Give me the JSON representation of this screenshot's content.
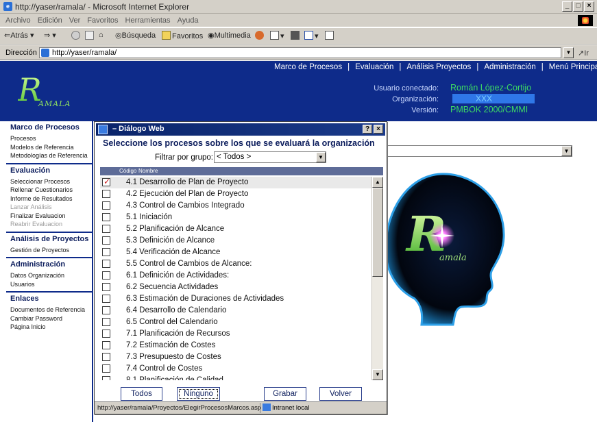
{
  "browser": {
    "title": "http://yaser/ramala/ - Microsoft Internet Explorer",
    "menu": [
      "Archivo",
      "Edición",
      "Ver",
      "Favoritos",
      "Herramientas",
      "Ayuda"
    ],
    "toolbar": {
      "back": "Atrás",
      "search": "Búsqueda",
      "favorites": "Favoritos",
      "media": "Multimedia"
    },
    "address_label": "Dirección",
    "address_value": "http://yaser/ramala/",
    "go_label": "Ir"
  },
  "header": {
    "nav": [
      "Marco de Procesos",
      "Evaluación",
      "Análisis Proyectos",
      "Administración",
      "Menú Principal"
    ],
    "logo_text": "R",
    "logo_sub": "AMALA",
    "user_label": "Usuario conectado:",
    "user_value": "Román López-Cortijo",
    "org_label": "Organización:",
    "org_value": "XXX",
    "version_label": "Versión:",
    "version_value": "PMBOK 2000/CMMI"
  },
  "sidebar": [
    {
      "title": "Marco de Procesos",
      "items": [
        {
          "label": "Procesos",
          "disabled": false
        },
        {
          "label": "Modelos de Referencia",
          "disabled": false
        },
        {
          "label": "Metodologías de Referencia",
          "disabled": false
        }
      ]
    },
    {
      "title": "Evaluación",
      "items": [
        {
          "label": "Seleccionar Procesos",
          "disabled": false
        },
        {
          "label": "Rellenar Cuestionarios",
          "disabled": false
        },
        {
          "label": "Informe de Resultados",
          "disabled": false
        },
        {
          "label": "Lanzar Análisis",
          "disabled": true
        },
        {
          "label": "Finalizar Evaluacion",
          "disabled": false
        },
        {
          "label": "Reabrir Evaluacion",
          "disabled": true
        }
      ]
    },
    {
      "title": "Análisis de Proyectos",
      "items": [
        {
          "label": "Gestión de Proyectos",
          "disabled": false
        }
      ]
    },
    {
      "title": "Administración",
      "items": [
        {
          "label": "Datos Organización",
          "disabled": false
        },
        {
          "label": "Usuarios",
          "disabled": false
        }
      ]
    },
    {
      "title": "Enlaces",
      "items": [
        {
          "label": "Documentos de Referencia",
          "disabled": false
        },
        {
          "label": "Cambiar Password",
          "disabled": false
        },
        {
          "label": "Página Inicio",
          "disabled": false
        }
      ]
    }
  ],
  "head_logo": {
    "text": "R",
    "sub": "amala"
  },
  "dialog": {
    "title": "– Diálogo Web",
    "help_btn": "?",
    "close_btn": "×",
    "heading": "Seleccione los procesos sobre los que se evaluará la organización",
    "filter_label": "Filtrar por grupo:",
    "filter_value": "< Todos >",
    "col_code": "Código",
    "col_name": "Nombre",
    "rows": [
      {
        "label": "4.1 Desarrollo de Plan de Proyecto",
        "checked": true
      },
      {
        "label": "4.2 Ejecución del Plan de Proyecto",
        "checked": false
      },
      {
        "label": "4.3 Control de Cambios Integrado",
        "checked": false
      },
      {
        "label": "5.1 Iniciación",
        "checked": false
      },
      {
        "label": "5.2 Planificación de Alcance",
        "checked": false
      },
      {
        "label": "5.3 Definición de Alcance",
        "checked": false
      },
      {
        "label": "5.4 Verificación de Alcance",
        "checked": false
      },
      {
        "label": "5.5 Control de Cambios de Alcance:",
        "checked": false
      },
      {
        "label": "6.1 Definición de Actividades:",
        "checked": false
      },
      {
        "label": "6.2 Secuencia Actividades",
        "checked": false
      },
      {
        "label": "6.3 Estimación de Duraciones de Actividades",
        "checked": false
      },
      {
        "label": "6.4 Desarrollo de Calendario",
        "checked": false
      },
      {
        "label": "6.5 Control del Calendario",
        "checked": false
      },
      {
        "label": "7.1 Planificación de Recursos",
        "checked": false
      },
      {
        "label": "7.2 Estimación de Costes",
        "checked": false
      },
      {
        "label": "7.3 Presupuesto de Costes",
        "checked": false
      },
      {
        "label": "7.4 Control de Costes",
        "checked": false
      },
      {
        "label": "8.1 Planificación de Calidad",
        "checked": false
      }
    ],
    "buttons": {
      "all": "Todos",
      "none": "Ninguno",
      "save": "Grabar",
      "back": "Volver"
    },
    "status_url": "http://yaser/ramala/Proyectos/ElegirProcesosMarcos.asp",
    "status_zone": "Intranet local"
  }
}
